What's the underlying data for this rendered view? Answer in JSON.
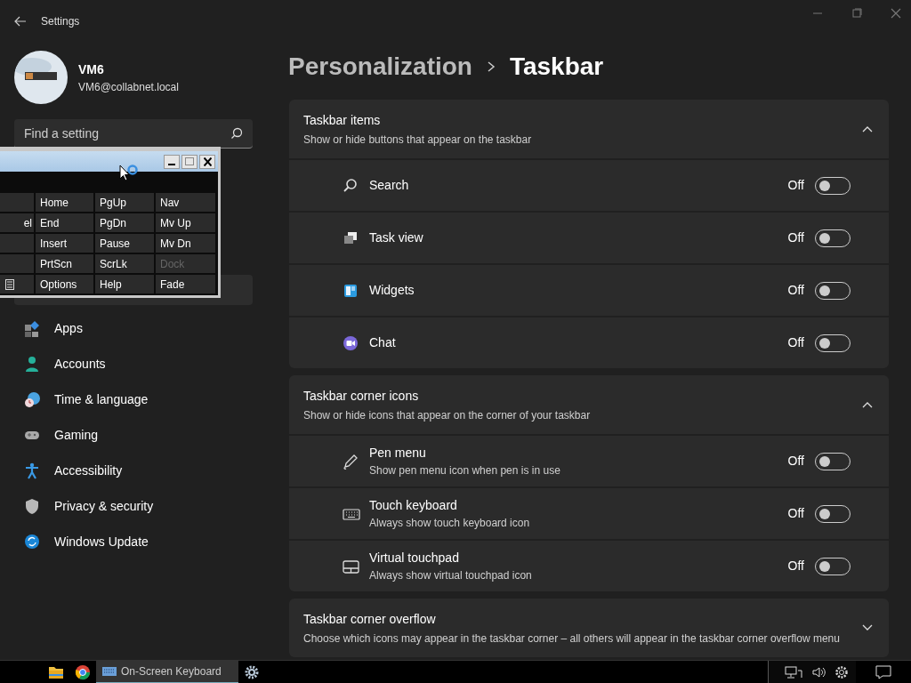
{
  "window": {
    "title": "Settings"
  },
  "user": {
    "name": "VM6",
    "email": "VM6@collabnet.local"
  },
  "search": {
    "placeholder": "Find a setting"
  },
  "nav": {
    "items": [
      {
        "label": "Apps",
        "selected": false
      },
      {
        "label": "Accounts",
        "selected": false
      },
      {
        "label": "Time & language",
        "selected": false
      },
      {
        "label": "Gaming",
        "selected": false
      },
      {
        "label": "Accessibility",
        "selected": false
      },
      {
        "label": "Privacy & security",
        "selected": false
      },
      {
        "label": "Windows Update",
        "selected": false
      }
    ]
  },
  "breadcrumb": [
    "Personalization",
    "Taskbar"
  ],
  "sections": [
    {
      "title": "Taskbar items",
      "subtitle": "Show or hide buttons that appear on the taskbar",
      "expanded": true,
      "items": [
        {
          "label": "Search",
          "state": "Off",
          "on": false
        },
        {
          "label": "Task view",
          "state": "Off",
          "on": false
        },
        {
          "label": "Widgets",
          "state": "Off",
          "on": false
        },
        {
          "label": "Chat",
          "state": "Off",
          "on": false
        }
      ]
    },
    {
      "title": "Taskbar corner icons",
      "subtitle": "Show or hide icons that appear on the corner of your taskbar",
      "expanded": true,
      "items": [
        {
          "label": "Pen menu",
          "description": "Show pen menu icon when pen is in use",
          "state": "Off",
          "on": false
        },
        {
          "label": "Touch keyboard",
          "description": "Always show touch keyboard icon",
          "state": "Off",
          "on": false
        },
        {
          "label": "Virtual touchpad",
          "description": "Always show virtual touchpad icon",
          "state": "Off",
          "on": false
        }
      ]
    },
    {
      "title": "Taskbar corner overflow",
      "subtitle": "Choose which icons may appear in the taskbar corner – all others will appear in the taskbar corner overflow menu",
      "expanded": false
    }
  ],
  "osk": {
    "rows": [
      [
        {
          "kind": "blank"
        },
        {
          "kind": "text",
          "label": "Home",
          "disabled": false
        },
        {
          "kind": "text",
          "label": "PgUp",
          "disabled": false
        },
        {
          "kind": "text",
          "label": "Nav",
          "disabled": false
        }
      ],
      [
        {
          "kind": "text",
          "label": "el",
          "disabled": false
        },
        {
          "kind": "text",
          "label": "End",
          "disabled": false
        },
        {
          "kind": "text",
          "label": "PgDn",
          "disabled": false
        },
        {
          "kind": "text",
          "label": "Mv Up",
          "disabled": false
        }
      ],
      [
        {
          "kind": "blank"
        },
        {
          "kind": "text",
          "label": "Insert",
          "disabled": false
        },
        {
          "kind": "text",
          "label": "Pause",
          "disabled": false
        },
        {
          "kind": "text",
          "label": "Mv Dn",
          "disabled": false
        }
      ],
      [
        {
          "kind": "blank"
        },
        {
          "kind": "text",
          "label": "PrtScn",
          "disabled": false
        },
        {
          "kind": "text",
          "label": "ScrLk",
          "disabled": false
        },
        {
          "kind": "text",
          "label": "Dock",
          "disabled": true
        }
      ],
      [
        {
          "kind": "menu"
        },
        {
          "kind": "text",
          "label": "Options",
          "disabled": false
        },
        {
          "kind": "text",
          "label": "Help",
          "disabled": false
        },
        {
          "kind": "text",
          "label": "Fade",
          "disabled": false
        }
      ]
    ]
  },
  "taskbar": {
    "buttons": [
      {
        "kind": "explorer",
        "selected": false
      },
      {
        "kind": "browser",
        "selected": false
      },
      {
        "kind": "osk",
        "label": "On-Screen Keyboard",
        "selected": true
      },
      {
        "kind": "settings",
        "selected": false
      }
    ]
  }
}
